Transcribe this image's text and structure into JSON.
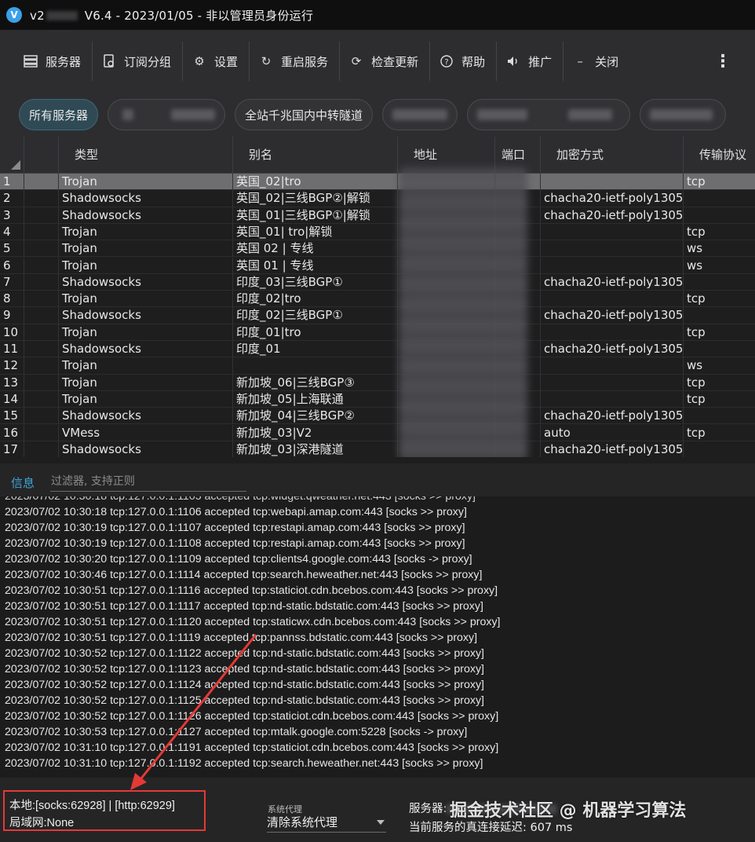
{
  "window": {
    "title_prefix": "v2",
    "title_suffix": "V6.4 - 2023/01/05 - 非以管理员身份运行"
  },
  "toolbar": [
    {
      "label": "服务器",
      "icon": "server-icon"
    },
    {
      "label": "订阅分组",
      "icon": "subscription-icon"
    },
    {
      "label": "设置",
      "icon": "gear-icon"
    },
    {
      "label": "重启服务",
      "icon": "restart-icon"
    },
    {
      "label": "检查更新",
      "icon": "update-icon"
    },
    {
      "label": "帮助",
      "icon": "help-icon"
    },
    {
      "label": "推广",
      "icon": "speaker-icon"
    },
    {
      "label": "关闭",
      "icon": "minus-icon"
    }
  ],
  "groups": {
    "all": "所有服务器",
    "tunnel": "全站千兆国内中转隧道"
  },
  "table": {
    "headers": [
      "类型",
      "别名",
      "地址",
      "端口",
      "加密方式",
      "传输协议"
    ],
    "rows": [
      [
        "1",
        "Trojan",
        "英国_02|tro",
        "",
        "tcp"
      ],
      [
        "2",
        "Shadowsocks",
        "英国_02|三线BGP②|解锁",
        "chacha20-ietf-poly1305",
        ""
      ],
      [
        "3",
        "Shadowsocks",
        "英国_01|三线BGP①|解锁",
        "chacha20-ietf-poly1305",
        ""
      ],
      [
        "4",
        "Trojan",
        "英国_01| tro|解锁",
        "",
        "tcp"
      ],
      [
        "5",
        "Trojan",
        "英国 02 | 专线",
        "",
        "ws"
      ],
      [
        "6",
        "Trojan",
        "英国 01 | 专线",
        "",
        "ws"
      ],
      [
        "7",
        "Shadowsocks",
        "印度_03|三线BGP①",
        "chacha20-ietf-poly1305",
        ""
      ],
      [
        "8",
        "Trojan",
        "印度_02|tro",
        "",
        "tcp"
      ],
      [
        "9",
        "Shadowsocks",
        "印度_02|三线BGP①",
        "chacha20-ietf-poly1305",
        ""
      ],
      [
        "10",
        "Trojan",
        "印度_01|tro",
        "",
        "tcp"
      ],
      [
        "11",
        "Shadowsocks",
        "印度_01",
        "chacha20-ietf-poly1305",
        ""
      ],
      [
        "12",
        "Trojan",
        "",
        "",
        "ws"
      ],
      [
        "13",
        "Trojan",
        "新加坡_06|三线BGP③",
        "",
        "tcp"
      ],
      [
        "14",
        "Trojan",
        "新加坡_05|上海联通",
        "",
        "tcp"
      ],
      [
        "15",
        "Shadowsocks",
        "新加坡_04|三线BGP②",
        "chacha20-ietf-poly1305",
        ""
      ],
      [
        "16",
        "VMess",
        "新加坡_03|V2",
        "auto",
        "tcp"
      ],
      [
        "17",
        "Shadowsocks",
        "新加坡_03|深港隧道",
        "chacha20-ietf-poly1305",
        ""
      ]
    ]
  },
  "info": {
    "tab_label": "信息",
    "filter_placeholder": "过滤器, 支持正则"
  },
  "log_lines": [
    "2023/07/02 10:30:18 tcp:127.0.0.1:1106 accepted tcp:webapi.amap.com:443 [socks >> proxy]",
    "2023/07/02 10:30:19 tcp:127.0.0.1:1107 accepted tcp:restapi.amap.com:443 [socks >> proxy]",
    "2023/07/02 10:30:19 tcp:127.0.0.1:1108 accepted tcp:restapi.amap.com:443 [socks >> proxy]",
    "2023/07/02 10:30:20 tcp:127.0.0.1:1109 accepted tcp:clients4.google.com:443 [socks -> proxy]",
    "2023/07/02 10:30:46 tcp:127.0.0.1:1114 accepted tcp:search.heweather.net:443 [socks >> proxy]",
    "2023/07/02 10:30:51 tcp:127.0.0.1:1116 accepted tcp:staticiot.cdn.bcebos.com:443 [socks >> proxy]",
    "2023/07/02 10:30:51 tcp:127.0.0.1:1117 accepted tcp:nd-static.bdstatic.com:443 [socks >> proxy]",
    "2023/07/02 10:30:51 tcp:127.0.0.1:1120 accepted tcp:staticwx.cdn.bcebos.com:443 [socks >> proxy]",
    "2023/07/02 10:30:51 tcp:127.0.0.1:1119 accepted tcp:pannss.bdstatic.com:443 [socks >> proxy]",
    "2023/07/02 10:30:52 tcp:127.0.0.1:1122 accepted tcp:nd-static.bdstatic.com:443 [socks >> proxy]",
    "2023/07/02 10:30:52 tcp:127.0.0.1:1123 accepted tcp:nd-static.bdstatic.com:443 [socks >> proxy]",
    "2023/07/02 10:30:52 tcp:127.0.0.1:1124 accepted tcp:nd-static.bdstatic.com:443 [socks >> proxy]",
    "2023/07/02 10:30:52 tcp:127.0.0.1:1125 accepted tcp:nd-static.bdstatic.com:443 [socks >> proxy]",
    "2023/07/02 10:30:52 tcp:127.0.0.1:1126 accepted tcp:staticiot.cdn.bcebos.com:443 [socks >> proxy]",
    "2023/07/02 10:30:53 tcp:127.0.0.1:1127 accepted tcp:mtalk.google.com:5228 [socks -> proxy]",
    "2023/07/02 10:31:10 tcp:127.0.0.1:1191 accepted tcp:staticiot.cdn.bcebos.com:443 [socks >> proxy]",
    "2023/07/02 10:31:10 tcp:127.0.0.1:1192 accepted tcp:search.heweather.net:443 [socks >> proxy]"
  ],
  "status": {
    "local": "本地:[socks:62928] | [http:62929]",
    "lan": "局域网:None",
    "proxy_caption": "系统代理",
    "proxy_value": "清除系统代理",
    "server_prefix": "服务器:",
    "delay": "当前服务的真连接延迟: 607 ms",
    "watermark": "掘金技术社区 @ 机器学习算法"
  },
  "colors": {
    "accent": "#3fa6d8",
    "annotation": "#e53935",
    "selected_row": "#6e6e70"
  }
}
